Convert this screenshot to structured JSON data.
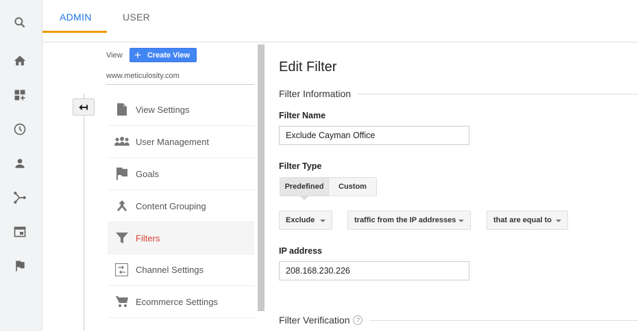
{
  "rail": {
    "icons": [
      "search-icon",
      "home-icon",
      "dashboard-icon",
      "clock-icon",
      "person-icon",
      "acquisition-icon",
      "behavior-icon",
      "flag-icon"
    ]
  },
  "tabs": {
    "admin": "ADMIN",
    "user": "USER"
  },
  "colors": {
    "accent": "#1a73e8",
    "tab_underline": "#f29900",
    "active_item": "#db4437"
  },
  "view": {
    "label": "View",
    "create_button": "Create View",
    "site": "www.meticulosity.com"
  },
  "menu": [
    {
      "label": "View Settings",
      "icon": "document-icon"
    },
    {
      "label": "User Management",
      "icon": "people-icon"
    },
    {
      "label": "Goals",
      "icon": "flag-icon"
    },
    {
      "label": "Content Grouping",
      "icon": "merge-icon"
    },
    {
      "label": "Filters",
      "icon": "filter-icon",
      "active": true
    },
    {
      "label": "Channel Settings",
      "icon": "channel-icon"
    },
    {
      "label": "Ecommerce Settings",
      "icon": "cart-icon"
    }
  ],
  "form": {
    "title": "Edit Filter",
    "section_info": "Filter Information",
    "name_label": "Filter Name",
    "name_value": "Exclude Cayman Office",
    "type_label": "Filter Type",
    "type_options": [
      "Predefined",
      "Custom"
    ],
    "selected_type": "Predefined",
    "dropdowns": [
      "Exclude",
      "traffic from the IP addresses",
      "that are equal to"
    ],
    "ip_label": "IP address",
    "ip_value": "208.168.230.226",
    "section_verify": "Filter Verification",
    "help": "?"
  }
}
